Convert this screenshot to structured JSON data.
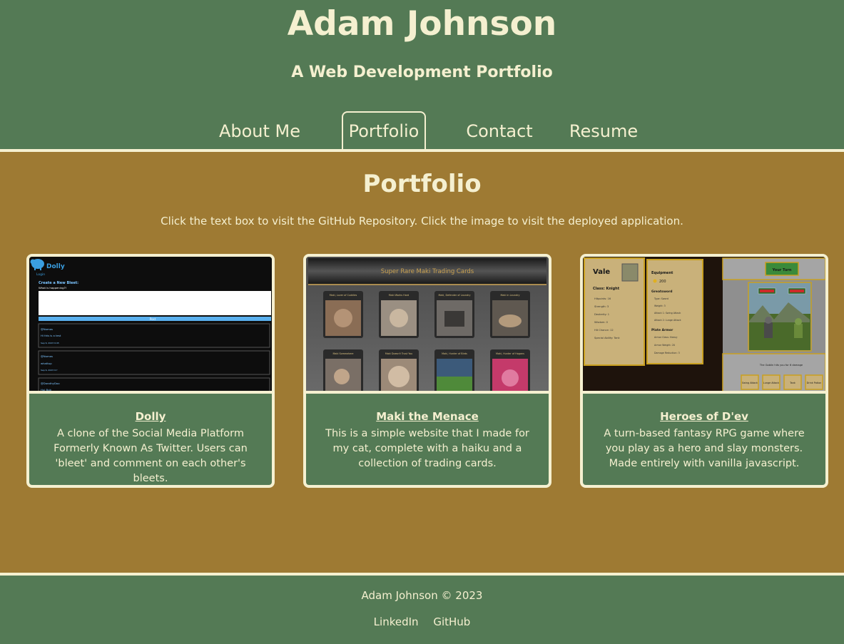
{
  "header": {
    "title": "Adam Johnson",
    "subtitle": "A Web Development Portfolio"
  },
  "nav": {
    "items": [
      {
        "label": "About Me",
        "active": false
      },
      {
        "label": "Portfolio",
        "active": true
      },
      {
        "label": "Contact",
        "active": false
      },
      {
        "label": "Resume",
        "active": false
      }
    ]
  },
  "main": {
    "title": "Portfolio",
    "instructions": "Click the text box to visit the GitHub Repository. Click the image to visit the deployed application."
  },
  "projects": [
    {
      "title": "Dolly",
      "description": "A clone of the Social Media Platform Formerly Known As Twitter. Users can 'bleet' and comment on each other's bleets.",
      "screenshot": {
        "app_name": "Dolly",
        "login": "Login",
        "heading": "Create a New Bleet:",
        "prompt": "What is happening?!",
        "button": "Post",
        "posts": [
          {
            "user": "@Nomas",
            "text": "Hi this is a test",
            "date": "Sep 6, 2023 9:45"
          },
          {
            "user": "@Nomas",
            "text": "whattup",
            "date": "Sep 6, 2023 9:?"
          },
          {
            "user": "@DorothyDoo",
            "text": "Hui Bub",
            "date": ""
          }
        ]
      }
    },
    {
      "title": "Maki the Menace",
      "description": "This is a simple website that I made for my cat, complete with a haiku and a collection of trading cards.",
      "screenshot": {
        "banner": "Super Rare Maki Trading Cards",
        "cards": [
          "Maki, Lover of Cuddles",
          "Maki Works Hard",
          "Maki, Defender of Laundry",
          "Maki in Laundry",
          "Maki Somewhere",
          "Maki Doesn't Trust You",
          "Maki, Hunter of Birds",
          "Maki, Hunter of Hogans"
        ]
      }
    },
    {
      "title": "Heroes of D'ev",
      "description": "A turn-based fantasy RPG game where you play as a hero and slay monsters. Made entirely with vanilla javascript.",
      "screenshot": {
        "hero_name": "Vale",
        "hero_class": "Class: Knight",
        "stats": [
          "Hitpoints: 16",
          "Strength: 3",
          "Dexterity: 1",
          "Wisdom: 0",
          "Hit Chance: 12",
          "Special Ability: Tank"
        ],
        "equipment_heading": "Equipment",
        "gold": "200",
        "weapon": "Greatsword",
        "weapon_stats": [
          "Type: Sword",
          "Weight: 3",
          "Attack 1: Swing Attack",
          "Attack 2: Lunge Attack"
        ],
        "armor": "Plate Armor",
        "armor_stats": [
          "Armor Class: Heavy",
          "Armor Weight: 20",
          "Damage Reduction: 3"
        ],
        "turn_label": "Your Turn",
        "battle_log": "The Goblin hits you for 6 damage",
        "actions": [
          "Swing Attack",
          "Lunge Attack",
          "Tank",
          "Drink Potion"
        ]
      }
    }
  ],
  "footer": {
    "copyright": "Adam Johnson © 2023",
    "links": [
      "LinkedIn",
      "GitHub"
    ]
  },
  "colors": {
    "header_green": "#547a55",
    "body_gold": "#9e7a33",
    "cream": "#f5f0d0"
  }
}
